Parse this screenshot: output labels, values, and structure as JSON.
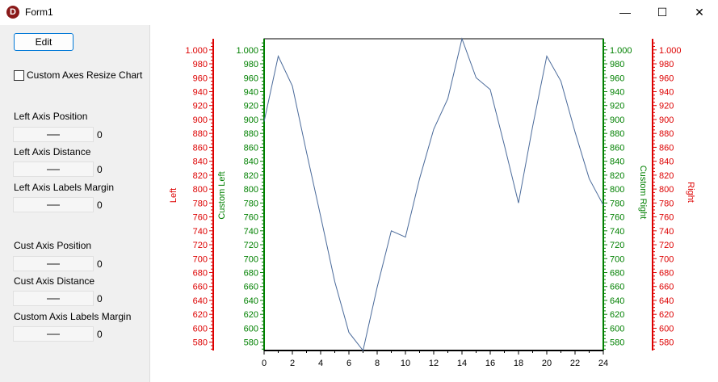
{
  "window": {
    "title": "Form1",
    "app_icon_letter": "D",
    "minimize_glyph": "—",
    "maximize_glyph": "☐",
    "close_glyph": "✕"
  },
  "controls": {
    "edit_label": "Edit",
    "checkbox_label": "Custom Axes Resize Chart",
    "checkbox_checked": false,
    "sliders": [
      {
        "label": "Left Axis Position",
        "value": "0"
      },
      {
        "label": "Left Axis Distance",
        "value": "0"
      },
      {
        "label": "Left Axis Labels Margin",
        "value": "0"
      },
      {
        "label": "Cust Axis Position",
        "value": "0"
      },
      {
        "label": "Cust Axis Distance",
        "value": "0"
      },
      {
        "label": "Custom Axis Labels Margin",
        "value": "0"
      }
    ]
  },
  "chart_data": {
    "type": "line",
    "x": [
      0,
      1,
      2,
      3,
      4,
      5,
      6,
      7,
      8,
      9,
      10,
      11,
      12,
      13,
      14,
      15,
      16,
      17,
      18,
      19,
      20,
      21,
      22,
      23,
      24
    ],
    "series": [
      {
        "values": [
          897,
          991,
          948,
          853,
          761,
          667,
          594,
          568,
          659,
          740,
          731,
          815,
          886,
          930,
          1016,
          960,
          943,
          863,
          780,
          890,
          991,
          955,
          882,
          815,
          777
        ]
      }
    ],
    "xlim": [
      0,
      24
    ],
    "x_ticks": [
      "0",
      "2",
      "4",
      "6",
      "8",
      "10",
      "12",
      "14",
      "16",
      "18",
      "20",
      "22",
      "24"
    ],
    "ylim": [
      568,
      1016
    ],
    "y_ticks": [
      "1.000",
      "980",
      "960",
      "940",
      "920",
      "900",
      "880",
      "860",
      "840",
      "820",
      "800",
      "780",
      "760",
      "740",
      "720",
      "700",
      "680",
      "660",
      "640",
      "620",
      "600",
      "580"
    ],
    "axes": {
      "left": "Left",
      "custom_left": "Custom Left",
      "custom_right": "Custom Right",
      "right": "Right"
    },
    "colors": {
      "red_axis": "#dd0000",
      "green_axis": "#008000",
      "series": "#4a6a9a"
    }
  }
}
